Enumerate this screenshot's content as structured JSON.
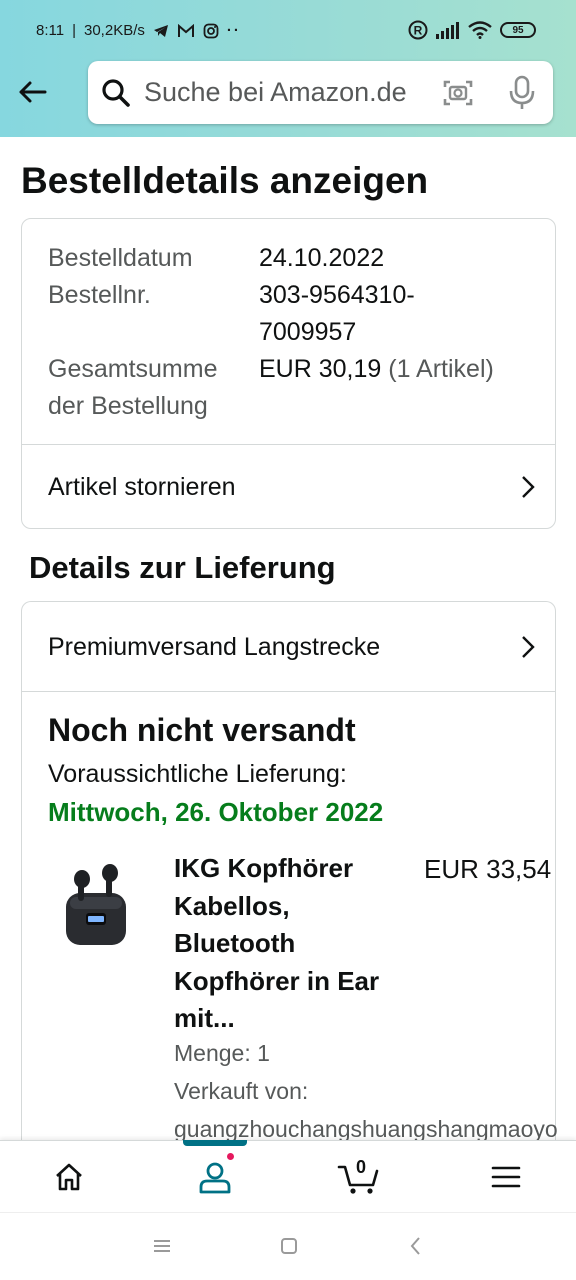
{
  "status_bar": {
    "time": "8:11",
    "speed": "30,2KB/s",
    "battery": "95"
  },
  "header": {
    "search_placeholder": "Suche bei Amazon.de"
  },
  "page": {
    "title": "Bestelldetails anzeigen"
  },
  "order_summary": {
    "date_label": "Bestelldatum",
    "date_value": "24.10.2022",
    "number_label": "Bestellnr.",
    "number_value_line1": "303-9564310-",
    "number_value_line2": "7009957",
    "total_label_line1": "Gesamtsumme",
    "total_label_line2": "der Bestellung",
    "total_value": "EUR 30,19",
    "total_items": "(1 Artikel)",
    "cancel_label": "Artikel stornieren"
  },
  "delivery": {
    "section_title": "Details zur Lieferung",
    "shipping_method": "Premiumversand Langstrecke",
    "status": "Noch nicht versandt",
    "eta_label": "Voraussichtliche Lieferung:",
    "eta_date": "Mittwoch, 26. Oktober 2022",
    "eta_color": "#067d1c"
  },
  "item": {
    "title_lines": [
      "IKG Kopfhörer",
      "Kabellos,",
      "Bluetooth",
      "Kopfhörer in Ear",
      "mit..."
    ],
    "price": "EUR 33,54",
    "quantity": "Menge: 1",
    "seller_label": "Verkauft von:",
    "seller_name": "guangzhouchangshuangshangmaoyo"
  },
  "bottom_nav": {
    "cart_count": "0",
    "active": "account",
    "accent": "#007185"
  }
}
